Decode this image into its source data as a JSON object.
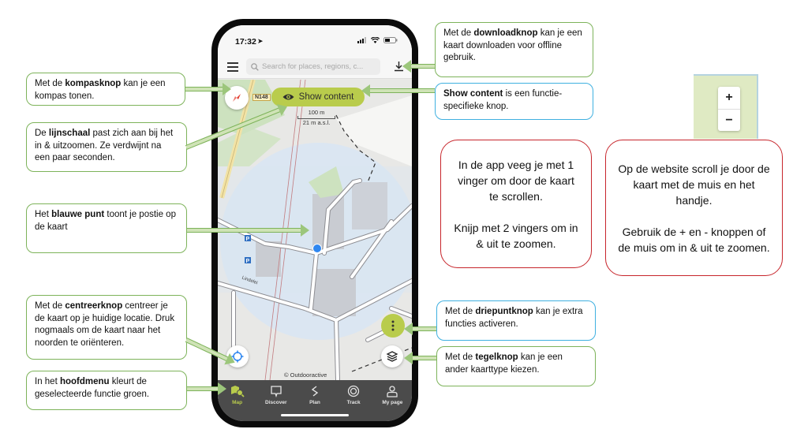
{
  "phone": {
    "status": {
      "time": "17:32"
    },
    "search": {
      "placeholder": "Search for places, regions, c..."
    },
    "map": {
      "road_badge": "N148",
      "show_content_label": "Show content",
      "scale_distance": "100 m",
      "scale_altitude": "21 m a.s.l.",
      "attribution": "© Outdooractive",
      "street_labels": [
        "Lindelei"
      ]
    },
    "tabs": [
      {
        "label": "Map",
        "icon": "map-icon",
        "active": true
      },
      {
        "label": "Discover",
        "icon": "discover-icon",
        "active": false
      },
      {
        "label": "Plan",
        "icon": "plan-icon",
        "active": false
      },
      {
        "label": "Track",
        "icon": "track-icon",
        "active": false
      },
      {
        "label": "My page",
        "icon": "profile-icon",
        "active": false
      }
    ]
  },
  "callouts": {
    "compass": {
      "pre": "Met de ",
      "bold": "kompasknop",
      "post": " kan je een kompas tonen."
    },
    "scale": {
      "pre": "De ",
      "bold": "lijnschaal",
      "post": " past zich aan bij het in & uitzoomen. Ze verdwijnt na een paar seconden."
    },
    "bluedot": {
      "pre": "Het ",
      "bold": "blauwe punt",
      "post": " toont je postie op de kaart"
    },
    "center": {
      "pre": "Met de ",
      "bold": "centreerknop",
      "post": " centreer je de kaart op je huidige locatie. Druk nogmaals om de kaart naar het noorden te oriënteren."
    },
    "mainmenu": {
      "pre": "In het ",
      "bold": "hoofdmenu",
      "post": " kleurt de geselecteerde functie groen."
    },
    "download": {
      "pre": "Met de ",
      "bold": "downloadknop",
      "post": " kan je een kaart downloaden voor offline gebruik."
    },
    "showcontent": {
      "pre": "",
      "bold": "Show content",
      "post": " is een functie-specifieke knop."
    },
    "threedots": {
      "pre": "Met de ",
      "bold": "driepuntknop",
      "post": " kan je extra functies activeren."
    },
    "layers": {
      "pre": "Met de ",
      "bold": "tegelknop",
      "post": " kan je een ander kaarttype kiezen."
    }
  },
  "notes": {
    "app": [
      "In de app veeg je met 1 vinger om door de kaart te scrollen.",
      "Knijp met 2 vingers om in & uit te zoomen."
    ],
    "website": [
      "Op de website scroll je door de kaart met de muis en het handje.",
      "Gebruik de + en - knoppen of de muis om in & uit te zoomen."
    ]
  },
  "website_zoom": {
    "plus": "+",
    "minus": "−"
  },
  "colors": {
    "accent_green": "#b9cc4c",
    "callout_green": "#7db35a",
    "callout_blue": "#3fb0e0",
    "note_red": "#c7252b",
    "location_blue": "#2f87f0"
  }
}
